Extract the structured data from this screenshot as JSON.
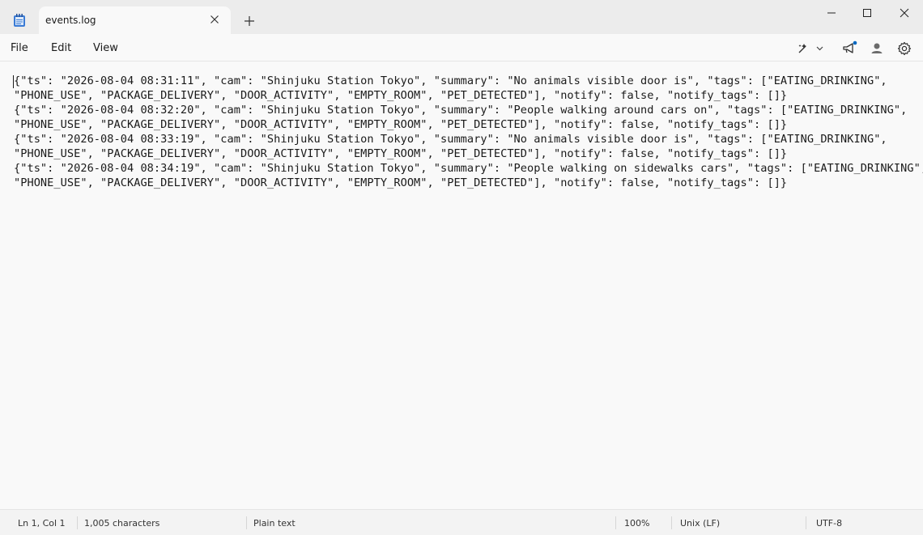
{
  "tab": {
    "title": "events.log"
  },
  "menu": {
    "file": "File",
    "edit": "Edit",
    "view": "View"
  },
  "editor": {
    "lines": [
      "{\"ts\": \"2026-08-04 08:31:11\", \"cam\": \"Shinjuku Station Tokyo\", \"summary\": \"No animals visible door is\", \"tags\": [\"EATING_DRINKING\",",
      "\"PHONE_USE\", \"PACKAGE_DELIVERY\", \"DOOR_ACTIVITY\", \"EMPTY_ROOM\", \"PET_DETECTED\"], \"notify\": false, \"notify_tags\": []}",
      "{\"ts\": \"2026-08-04 08:32:20\", \"cam\": \"Shinjuku Station Tokyo\", \"summary\": \"People walking around cars on\", \"tags\": [\"EATING_DRINKING\",",
      "\"PHONE_USE\", \"PACKAGE_DELIVERY\", \"DOOR_ACTIVITY\", \"EMPTY_ROOM\", \"PET_DETECTED\"], \"notify\": false, \"notify_tags\": []}",
      "{\"ts\": \"2026-08-04 08:33:19\", \"cam\": \"Shinjuku Station Tokyo\", \"summary\": \"No animals visible door is\", \"tags\": [\"EATING_DRINKING\",",
      "\"PHONE_USE\", \"PACKAGE_DELIVERY\", \"DOOR_ACTIVITY\", \"EMPTY_ROOM\", \"PET_DETECTED\"], \"notify\": false, \"notify_tags\": []}",
      "{\"ts\": \"2026-08-04 08:34:19\", \"cam\": \"Shinjuku Station Tokyo\", \"summary\": \"People walking on sidewalks cars\", \"tags\": [\"EATING_DRINKING\",",
      "\"PHONE_USE\", \"PACKAGE_DELIVERY\", \"DOOR_ACTIVITY\", \"EMPTY_ROOM\", \"PET_DETECTED\"], \"notify\": false, \"notify_tags\": []}"
    ]
  },
  "status": {
    "position": "Ln 1, Col 1",
    "characters": "1,005 characters",
    "format": "Plain text",
    "zoom": "100%",
    "line_ending": "Unix (LF)",
    "encoding": "UTF-8"
  },
  "icons": {
    "app": "notepad-icon",
    "close_tab": "close-icon",
    "new_tab": "plus-icon",
    "copilot": "copilot-icon",
    "share": "megaphone-icon",
    "account": "account-icon",
    "settings": "gear-icon"
  },
  "colors": {
    "notify_dot": "#0067c0"
  }
}
